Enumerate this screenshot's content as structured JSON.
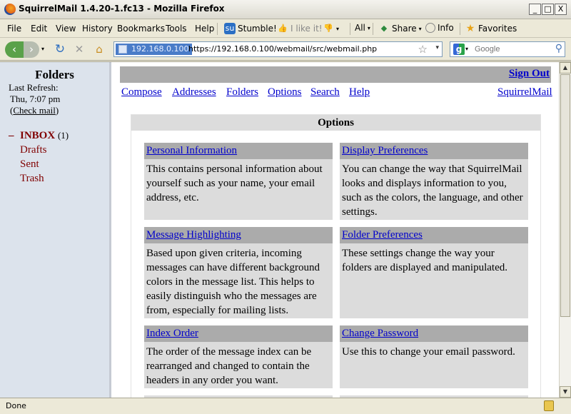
{
  "window": {
    "title": "SquirrelMail 1.4.20-1.fc13 - Mozilla Firefox",
    "min": "_",
    "max": "□",
    "close": "X"
  },
  "menubar": {
    "items": [
      "File",
      "Edit",
      "View",
      "History",
      "Bookmarks",
      "Tools",
      "Help"
    ],
    "stumble": "Stumble!",
    "ilike": "I like it!",
    "all": "All",
    "share": "Share",
    "info": "Info",
    "favorites": "Favorites"
  },
  "nav": {
    "site_identity": "192.168.0.100",
    "url": "https://192.168.0.100/webmail/src/webmail.php",
    "search_placeholder": "Google"
  },
  "left": {
    "title": "Folders",
    "last_refresh_label": "Last Refresh:",
    "last_refresh_time": "Thu, 7:07 pm",
    "check_mail": "Check mail",
    "inbox": "INBOX",
    "inbox_count": "(1)",
    "folders": [
      "Drafts",
      "Sent",
      "Trash"
    ]
  },
  "right": {
    "sign_out": "Sign Out",
    "links": [
      "Compose",
      "Addresses",
      "Folders",
      "Options",
      "Search",
      "Help"
    ],
    "brand_link": "SquirrelMail",
    "options_title": "Options",
    "options": [
      {
        "title": "Personal Information",
        "desc": "This contains personal information about yourself such as your name, your email address, etc."
      },
      {
        "title": "Display Preferences",
        "desc": "You can change the way that SquirrelMail looks and displays information to you, such as the colors, the language, and other settings."
      },
      {
        "title": "Message Highlighting",
        "desc": "Based upon given criteria, incoming messages can have different background colors in the message list. This helps to easily distinguish who the messages are from, especially for mailing lists."
      },
      {
        "title": "Folder Preferences",
        "desc": "These settings change the way your folders are displayed and manipulated."
      },
      {
        "title": "Index Order",
        "desc": "The order of the message index can be rearranged and changed to contain the headers in any order you want."
      },
      {
        "title": "Change Password",
        "desc": "Use this to change your email password."
      }
    ]
  },
  "status": {
    "text": "Done"
  }
}
